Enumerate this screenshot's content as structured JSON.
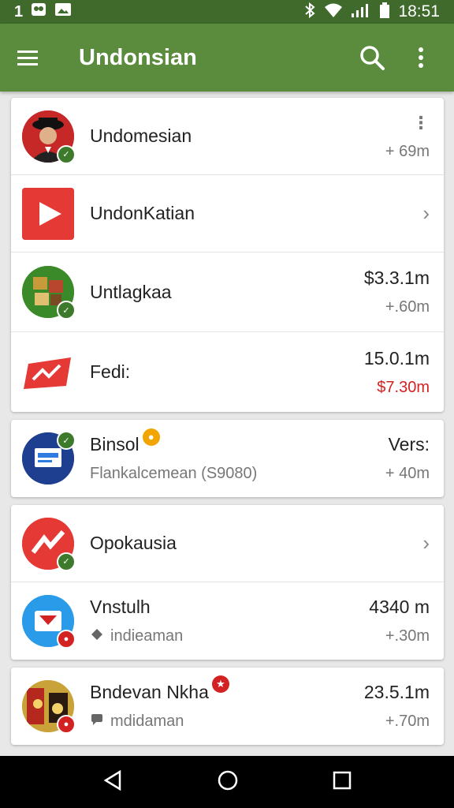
{
  "status_bar": {
    "left_text": "1",
    "time": "18:51"
  },
  "app_bar": {
    "title": "Undonsian"
  },
  "cards": [
    {
      "rows": [
        {
          "primary": "Undomesian",
          "bottom_right": "+ 69m",
          "trailing": "kebab"
        },
        {
          "primary": "UndonKatian",
          "trailing": "chevron"
        },
        {
          "primary": "Untlagkaa",
          "top_right": "$3.3.1m",
          "bottom_right": "+.60m"
        },
        {
          "primary": "Fedi:",
          "top_right": "15.0.1m",
          "bottom_right": "$7.30m",
          "bottom_right_color": "#d32222"
        }
      ]
    },
    {
      "rows": [
        {
          "primary": "Binsol",
          "secondary": "Flankalcemean (S9080)",
          "top_right": "Vers:",
          "bottom_right": "+ 40m"
        }
      ]
    },
    {
      "rows": [
        {
          "primary": "Opokausia",
          "trailing": "chevron"
        },
        {
          "primary": "Vnstulh",
          "secondary": "indieaman",
          "top_right": "4340 m",
          "bottom_right": "+.30m"
        }
      ]
    },
    {
      "rows": [
        {
          "primary": "Bndevan Nkha",
          "secondary": "mdidaman",
          "top_right": "23.5.1m",
          "bottom_right": "+.70m"
        }
      ]
    }
  ],
  "colors": {
    "app_bar": "#5b8b3c",
    "status_bar": "#3f6a2c",
    "accent_red": "#d32222",
    "badge_green": "#3d7a2b"
  }
}
